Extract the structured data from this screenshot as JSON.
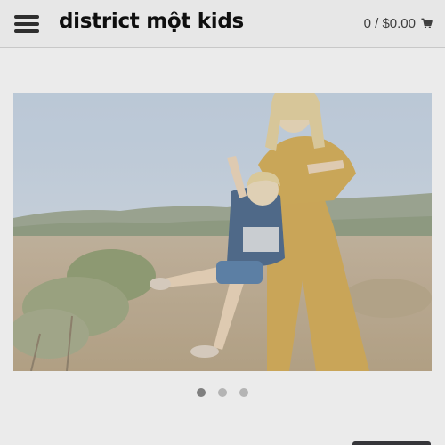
{
  "header": {
    "logo": "district một kids",
    "cart_label": "0 / $0.00",
    "menu_icon": "hamburger-menu-icon",
    "cart_icon": "shopping-cart-icon"
  },
  "carousel": {
    "slide_count": 3,
    "active_index": 0
  },
  "colors": {
    "header_bg": "#fbfbfb",
    "text": "#111111",
    "dot_active": "#8a8a8a",
    "dot_inactive": "#c4c4c4"
  }
}
